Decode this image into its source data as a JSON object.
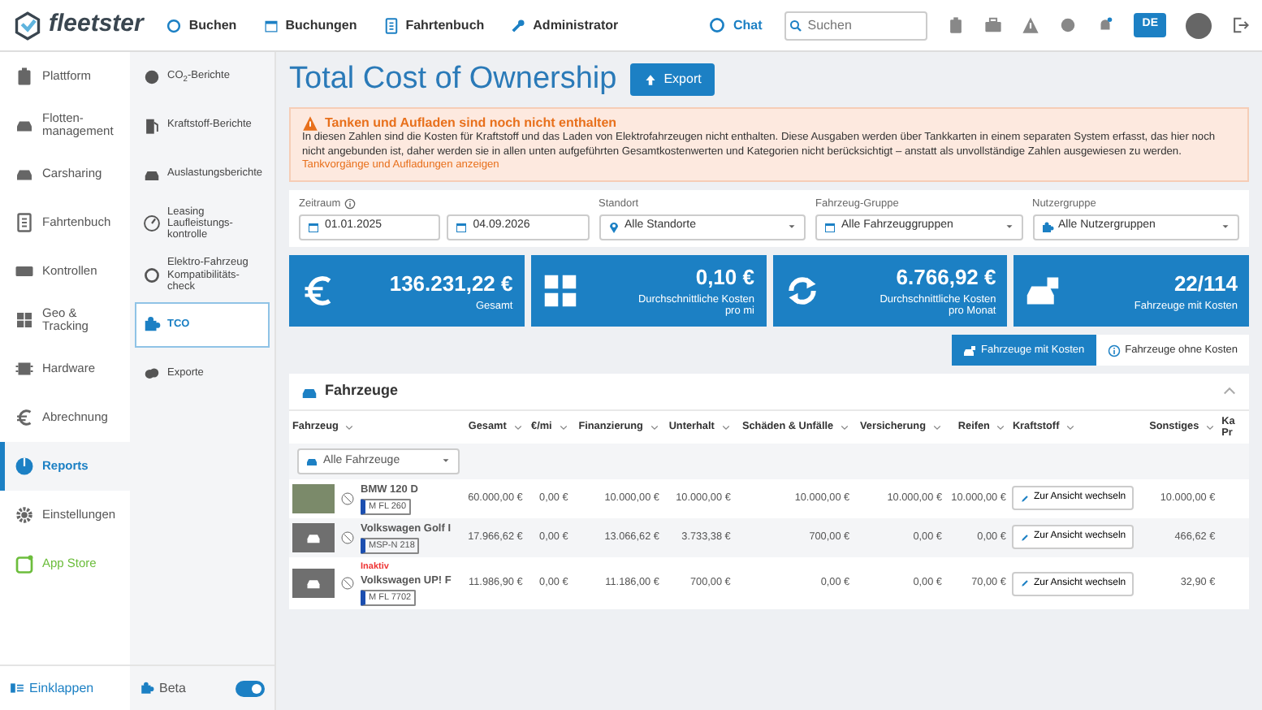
{
  "topbar": {
    "logo": "fleetster",
    "nav": [
      "Buchen",
      "Buchungen",
      "Fahrtenbuch",
      "Administrator"
    ],
    "chat": "Chat",
    "search": {
      "placeholder": "Suchen"
    },
    "language": "DE"
  },
  "sidebar": {
    "items": [
      {
        "label": "Plattform",
        "selected": false
      },
      {
        "label": "Flotten-management",
        "selected": false
      },
      {
        "label": "Carsharing",
        "selected": false
      },
      {
        "label": "Fahrtenbuch",
        "selected": false
      },
      {
        "label": "Kontrollen",
        "selected": false
      },
      {
        "label": "Geo & Tracking",
        "selected": false
      },
      {
        "label": "Hardware",
        "selected": false
      },
      {
        "label": "Abrechnung",
        "selected": false
      },
      {
        "label": "Reports",
        "selected": true
      },
      {
        "label": "Einstellungen",
        "selected": false
      },
      {
        "label": "App Store",
        "selected": false
      }
    ],
    "collapse": "Einklappen"
  },
  "subnav": {
    "items": [
      {
        "label": "CO$_{2}$-Berichte",
        "selected": false
      },
      {
        "label": "Kraftstoff-Berichte",
        "selected": false
      },
      {
        "label": "Auslastungsberichte",
        "selected": false
      },
      {
        "label": "Leasing Laufleistungs-kontrolle",
        "selected": false
      },
      {
        "label": "Elektro-Fahrzeug Kompatibilitäts-check",
        "selected": false
      },
      {
        "label": "TCO",
        "selected": true
      },
      {
        "label": "Exporte",
        "selected": false
      }
    ],
    "beta": {
      "label": "Beta",
      "on": true
    }
  },
  "page": {
    "title": "Total Cost of Ownership",
    "export": "Export"
  },
  "alert": {
    "title": "Tanken und Aufladen sind noch nicht enthalten",
    "text": "In diesen Zahlen sind die Kosten für Kraftstoff und das Laden von Elektrofahrzeugen nicht enthalten. Diese Ausgaben werden über Tankkarten in einem separaten System erfasst, das hier noch nicht angebunden ist, daher werden sie in allen unten aufgeführten Gesamtkostenwerten und Kategorien nicht berücksichtigt – anstatt als unvollständige Zahlen ausgewiesen zu werden.",
    "link": "Tankvorgänge und Aufladungen anzeigen"
  },
  "filters": [
    {
      "kind": "daterange",
      "label": "Zeitraum",
      "values": [
        "01.01.2025",
        "04.09.2026"
      ]
    },
    {
      "kind": "select",
      "label": "Standort",
      "value": "Alle Standorte"
    },
    {
      "kind": "select",
      "label": "Fahrzeug-Gruppe",
      "value": "Alle Fahrzeuggruppen"
    },
    {
      "kind": "select",
      "label": "Nutzergruppe",
      "value": "Alle Nutzergruppen"
    }
  ],
  "stats": [
    {
      "value": "136.231,22 €",
      "label": "Gesamt"
    },
    {
      "value": "0,10 €",
      "label": "Durchschnittliche Kosten pro mi"
    },
    {
      "value": "6.766,92 €",
      "label": "Durchschnittliche Kosten pro Monat"
    },
    {
      "value": "22/114",
      "label": "Fahrzeuge mit Kosten"
    }
  ],
  "view_toggle": [
    {
      "label": "Fahrzeuge mit Kosten",
      "selected": true
    },
    {
      "label": "Fahrzeuge ohne Kosten",
      "selected": false
    }
  ],
  "vehicles": {
    "title": "Fahrzeuge",
    "expanded": true,
    "columns": [
      "Fahrzeug",
      "Gesamt",
      "€/mi",
      "Finanzierung",
      "Unterhalt",
      "Schäden & Unfälle",
      "Versicherung",
      "Reifen",
      "Kraftstoff",
      "Sonstiges",
      "Ka Pr"
    ],
    "filter": "Alle Fahrzeuge",
    "rows": [
      {
        "cells": [
          {
            "kind": "vehicle",
            "photo": true,
            "name": "BMW 120 D",
            "plate": "M FL 260"
          },
          "60.000,00 €",
          "0,00 €",
          "10.000,00 €",
          "10.000,00 €",
          "10.000,00 €",
          "10.000,00 €",
          "10.000,00 €",
          {
            "kind": "button",
            "label": "Zur Ansicht wechseln"
          },
          "10.000,00 €"
        ]
      },
      {
        "cells": [
          {
            "kind": "vehicle",
            "photo": false,
            "name": "Volkswagen Golf I",
            "plate": "MSP-N 218"
          },
          "17.966,62 €",
          "0,00 €",
          "13.066,62 €",
          "3.733,38 €",
          "700,00 €",
          "0,00 €",
          "0,00 €",
          {
            "kind": "button",
            "label": "Zur Ansicht wechseln"
          },
          "466,62 €"
        ]
      },
      {
        "cells": [
          {
            "kind": "vehicle",
            "photo": false,
            "status": "Inaktiv",
            "name": "Volkswagen UP! F",
            "plate": "M FL 7702"
          },
          "11.986,90 €",
          "0,00 €",
          "11.186,00 €",
          "700,00 €",
          "0,00 €",
          "0,00 €",
          "70,00 €",
          {
            "kind": "button",
            "label": "Zur Ansicht wechseln"
          },
          "32,90 €"
        ]
      }
    ]
  }
}
